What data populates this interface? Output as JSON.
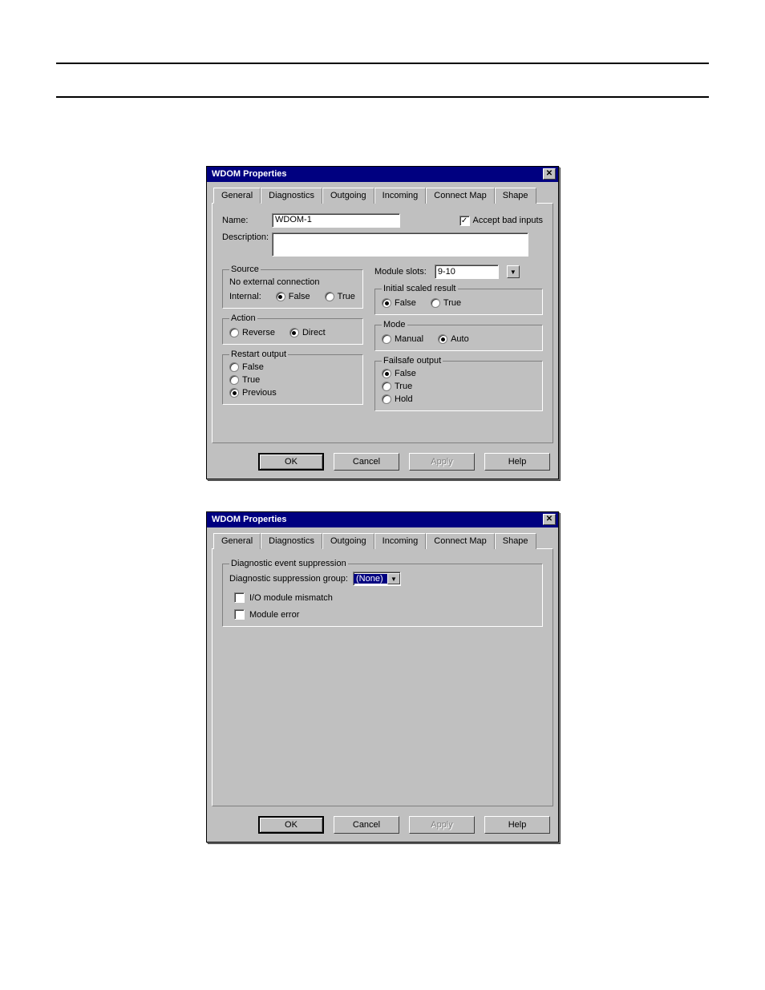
{
  "dialog": {
    "title": "WDOM Properties",
    "close_glyph": "✕",
    "tabs": [
      "General",
      "Diagnostics",
      "Outgoing",
      "Incoming",
      "Connect Map",
      "Shape"
    ],
    "buttons": {
      "ok": "OK",
      "cancel": "Cancel",
      "apply": "Apply",
      "help": "Help"
    }
  },
  "general": {
    "name_label": "Name:",
    "name_value": "WDOM-1",
    "desc_label": "Description:",
    "desc_value": "",
    "accept_bad_label": "Accept bad inputs",
    "accept_bad_checked": true,
    "source": {
      "legend": "Source",
      "no_ext": "No external connection",
      "internal_label": "Internal:",
      "option_false": "False",
      "option_true": "True"
    },
    "action": {
      "legend": "Action",
      "reverse": "Reverse",
      "direct": "Direct"
    },
    "restart": {
      "legend": "Restart output",
      "false": "False",
      "true": "True",
      "previous": "Previous"
    },
    "module_slots_label": "Module slots:",
    "module_slots_value": "9-10",
    "initial_scaled": {
      "legend": "Initial scaled result",
      "false": "False",
      "true": "True"
    },
    "mode": {
      "legend": "Mode",
      "manual": "Manual",
      "auto": "Auto"
    },
    "failsafe": {
      "legend": "Failsafe output",
      "false": "False",
      "true": "True",
      "hold": "Hold"
    }
  },
  "diagnostics": {
    "legend": "Diagnostic event suppression",
    "group_label": "Diagnostic suppression group:",
    "group_value": "(None)",
    "io_mismatch": "I/O module mismatch",
    "module_error": "Module error"
  }
}
